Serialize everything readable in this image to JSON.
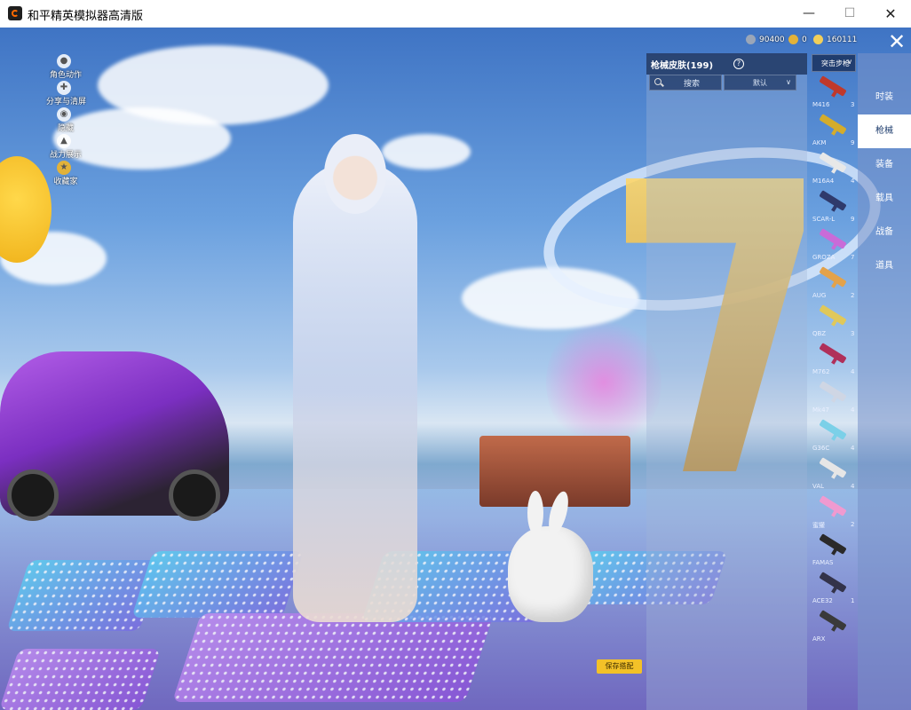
{
  "window": {
    "title": "和平精英模拟器高清版",
    "minimize_glyph": "—",
    "maximize_glyph": "☐",
    "close_glyph": "✕"
  },
  "left_menu": [
    {
      "icon": "person-icon",
      "label": "角色动作"
    },
    {
      "icon": "share-icon",
      "label": "分享与清屏"
    },
    {
      "icon": "eye-icon",
      "label": "隐藏"
    },
    {
      "icon": "power-icon",
      "label": "战力展示"
    },
    {
      "icon": "collection-icon",
      "label": "收藏家"
    }
  ],
  "currency": [
    {
      "icon": "coin-icon",
      "value": "90400",
      "color": "#9aa6b8"
    },
    {
      "icon": "gold-icon",
      "value": "0",
      "color": "#e2b23a"
    },
    {
      "icon": "gem-icon",
      "value": "160111",
      "color": "#f2cf5a"
    }
  ],
  "close_glyph": "✕",
  "skin_panel": {
    "title": "枪械皮肤(199)",
    "help_glyph": "?",
    "search_label": "搜索",
    "sort_label": "默认",
    "sort_chevron": "∨"
  },
  "category_dropdown": {
    "label": "突击步枪",
    "chevron": "∨"
  },
  "weapons": [
    {
      "name": "M416",
      "count": "3",
      "color": "#c0392b"
    },
    {
      "name": "AKM",
      "count": "9",
      "color": "#d4ac2c"
    },
    {
      "name": "M16A4",
      "count": "4",
      "color": "#e8e8e8"
    },
    {
      "name": "SCAR-L",
      "count": "9",
      "color": "#2f3a6b"
    },
    {
      "name": "GROZA",
      "count": "7",
      "color": "#c96bd8"
    },
    {
      "name": "AUG",
      "count": "2",
      "color": "#e3a24a"
    },
    {
      "name": "QBZ",
      "count": "3",
      "color": "#e0c85a"
    },
    {
      "name": "M762",
      "count": "4",
      "color": "#b0305a"
    },
    {
      "name": "Mk47",
      "count": "4",
      "color": "#cfd6e4"
    },
    {
      "name": "G36C",
      "count": "4",
      "color": "#7bd0e8"
    },
    {
      "name": "VAL",
      "count": "4",
      "color": "#e6e6e6"
    },
    {
      "name": "蜜獾",
      "count": "2",
      "color": "#f09ad0"
    },
    {
      "name": "FAMAS",
      "count": "",
      "color": "#2a2a2a"
    },
    {
      "name": "ACE32",
      "count": "1",
      "color": "#33334a"
    },
    {
      "name": "ARX",
      "count": "",
      "color": "#3a3a3a"
    }
  ],
  "tabs": [
    {
      "label": "时装",
      "active": false
    },
    {
      "label": "枪械",
      "active": true
    },
    {
      "label": "装备",
      "active": false
    },
    {
      "label": "载具",
      "active": false
    },
    {
      "label": "战备",
      "active": false
    },
    {
      "label": "道具",
      "active": false
    }
  ],
  "save_button": "保存搭配",
  "colors": {
    "accent": "#f3c128",
    "panel_header": "#142850",
    "tab_active_text": "#1b3a6b"
  }
}
